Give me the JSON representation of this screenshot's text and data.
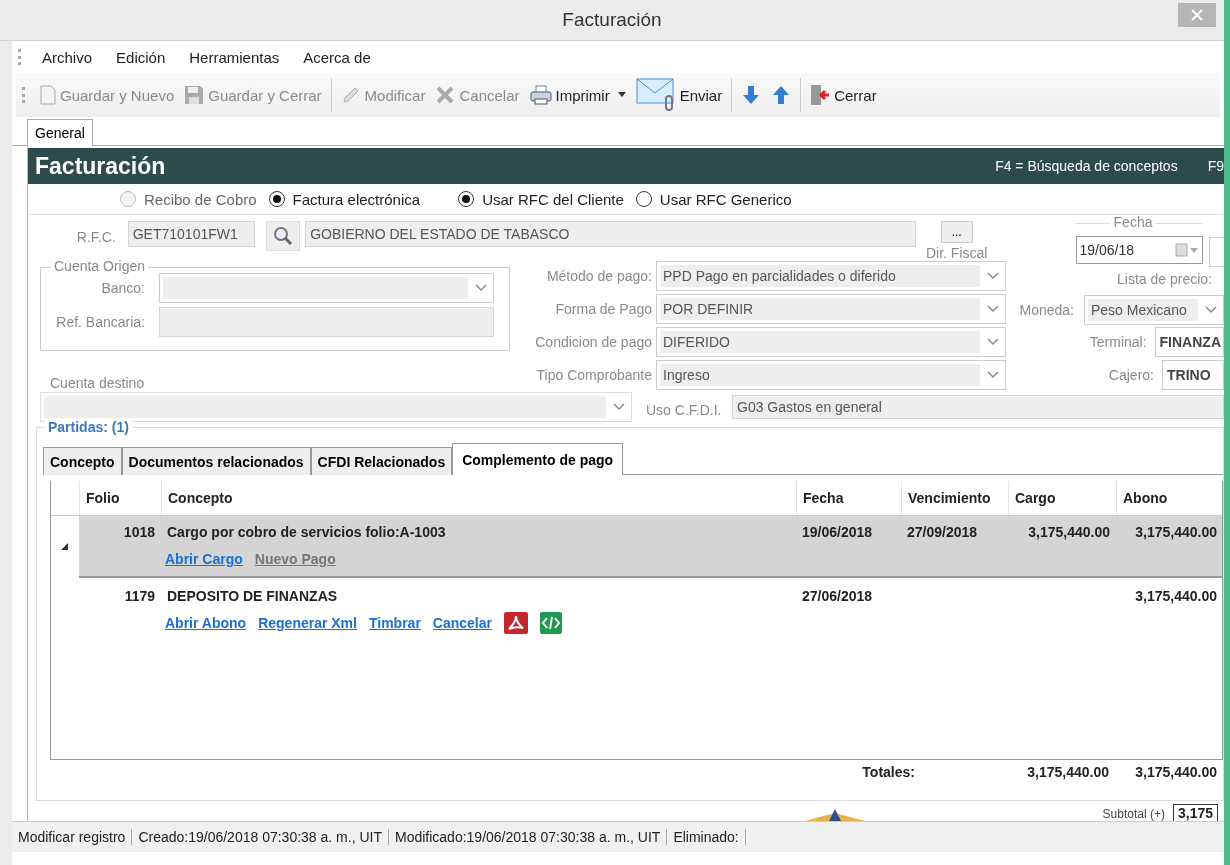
{
  "window": {
    "title": "Facturación"
  },
  "menu": [
    "Archivo",
    "Edición",
    "Herramientas",
    "Acerca de"
  ],
  "toolbar": {
    "guardar_nuevo": {
      "label": "Guardar y Nuevo",
      "disabled": true
    },
    "guardar_cerrar": {
      "label": "Guardar y Cerrar",
      "disabled": true
    },
    "modificar": {
      "label": "Modificar",
      "disabled": true
    },
    "cancelar": {
      "label": "Cancelar",
      "disabled": true
    },
    "imprimir": {
      "label": "Imprimir",
      "disabled": false
    },
    "enviar": {
      "label": "Enviar",
      "disabled": false
    },
    "cerrar": {
      "label": "Cerrar",
      "disabled": false
    }
  },
  "page_tabs": [
    {
      "label": "General",
      "selected": true
    }
  ],
  "header": {
    "title": "Facturación",
    "hint": "F4 = Búsqueda de conceptos",
    "hint_2": "F9"
  },
  "document_type": [
    {
      "label": "Recibo de Cobro",
      "selected": false,
      "disabled": true
    },
    {
      "label": "Factura electrónica",
      "selected": true,
      "disabled": false
    }
  ],
  "rfc_mode": [
    {
      "label": "Usar RFC del Cliente",
      "selected": true
    },
    {
      "label": "Usar RFC Generico",
      "selected": false
    }
  ],
  "client": {
    "rfc_label": "R.F.C.",
    "rfc": "GET710101FW1",
    "name": "GOBIERNO DEL ESTADO DE TABASCO",
    "more_button": "...",
    "dir_fiscal": "Dir. Fiscal"
  },
  "fecha": {
    "label": "Fecha",
    "value": "19/06/18"
  },
  "cuenta_origen": {
    "title": "Cuenta Origen",
    "banco_label": "Banco:",
    "ref_label": "Ref. Bancaria:"
  },
  "cuenta_destino": {
    "label": "Cuenta destino"
  },
  "payment": [
    {
      "label": "Método de pago:",
      "value": "PPD Pago en parcialidades o diferido"
    },
    {
      "label": "Forma de Pago",
      "value": "POR DEFINIR"
    },
    {
      "label": "Condicion de pago",
      "value": "DIFERIDO"
    },
    {
      "label": "Tipo Comprobante",
      "value": "Ingreso"
    }
  ],
  "uso_cfdi": {
    "label": "Uso C.F.D.I.",
    "value": "G03 Gastos en general"
  },
  "lista_precio": {
    "label": "Lista de precio:"
  },
  "moneda": {
    "label": "Moneda:",
    "value": "Peso Mexicano"
  },
  "terminal": {
    "label": "Terminal:",
    "value": "FINANZA"
  },
  "cajero": {
    "label": "Cajero:",
    "value": "TRINO"
  },
  "partidas": {
    "title": "Partidas: (1)",
    "tabs": [
      {
        "label": "Concepto",
        "selected": false
      },
      {
        "label": "Documentos relacionados",
        "selected": false
      },
      {
        "label": "CFDI Relacionados",
        "selected": false
      },
      {
        "label": "Complemento de pago",
        "selected": true
      }
    ],
    "columns": [
      "Folio",
      "Concepto",
      "Fecha",
      "Vencimiento",
      "Cargo",
      "Abono"
    ],
    "rows": [
      {
        "folio": "1018",
        "concepto": "Cargo por cobro de servicios folio:A-1003",
        "fecha": "19/06/2018",
        "vencimiento": "27/09/2018",
        "cargo": "3,175,440.00",
        "abono": "3,175,440.00",
        "selected": true,
        "expandable": true,
        "documents": false,
        "links": [
          {
            "label": "Abrir Cargo",
            "disabled": false
          },
          {
            "label": "Nuevo Pago",
            "disabled": true
          }
        ]
      },
      {
        "folio": "1179",
        "concepto": "DEPOSITO DE FINANZAS",
        "fecha": "27/06/2018",
        "vencimiento": "",
        "cargo": "",
        "abono": "3,175,440.00",
        "selected": false,
        "expandable": false,
        "documents": true,
        "links": [
          {
            "label": "Abrir Abono",
            "disabled": false
          },
          {
            "label": "Regenerar Xml",
            "disabled": false
          },
          {
            "label": "Timbrar",
            "disabled": false
          },
          {
            "label": "Cancelar",
            "disabled": false
          }
        ]
      }
    ],
    "totals": {
      "label": "Totales:",
      "cargo": "3,175,440.00",
      "abono": "3,175,440.00"
    }
  },
  "subtotal": {
    "label": "Subtotal (+)",
    "value": "3,175"
  },
  "status_bar": [
    "Modificar registro",
    "Creado:19/06/2018 07:30:38 a. m., UIT",
    "Modificado:19/06/2018 07:30:38 a. m., UIT",
    "Eliminado:"
  ]
}
